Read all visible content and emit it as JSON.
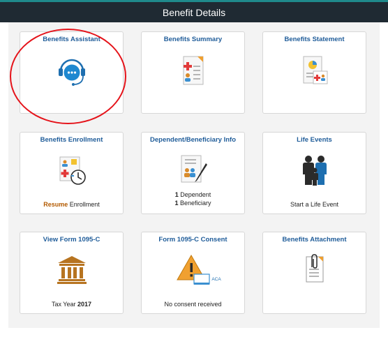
{
  "header": {
    "title": "Benefit Details"
  },
  "tiles": {
    "assistant": {
      "title": "Benefits Assistant"
    },
    "summary": {
      "title": "Benefits Summary"
    },
    "statement": {
      "title": "Benefits Statement"
    },
    "enrollment": {
      "title": "Benefits Enrollment",
      "status_word": "Resume",
      "status_rest": "Enrollment"
    },
    "dependent": {
      "title": "Dependent/Beneficiary Info",
      "dep_count": "1",
      "dep_label": "Dependent",
      "ben_count": "1",
      "ben_label": "Beneficiary"
    },
    "life": {
      "title": "Life Events",
      "text": "Start a Life Event"
    },
    "form1095": {
      "title": "View Form 1095-C",
      "year_label": "Tax Year",
      "year": "2017"
    },
    "consent": {
      "title": "Form 1095-C Consent",
      "text": "No consent received",
      "badge": "ACA"
    },
    "attachment": {
      "title": "Benefits Attachment"
    }
  },
  "colors": {
    "header_bg": "#1f2a33",
    "title_blue": "#1f5c99",
    "accent_orange": "#b35a00",
    "annotation_red": "#e5131a"
  }
}
